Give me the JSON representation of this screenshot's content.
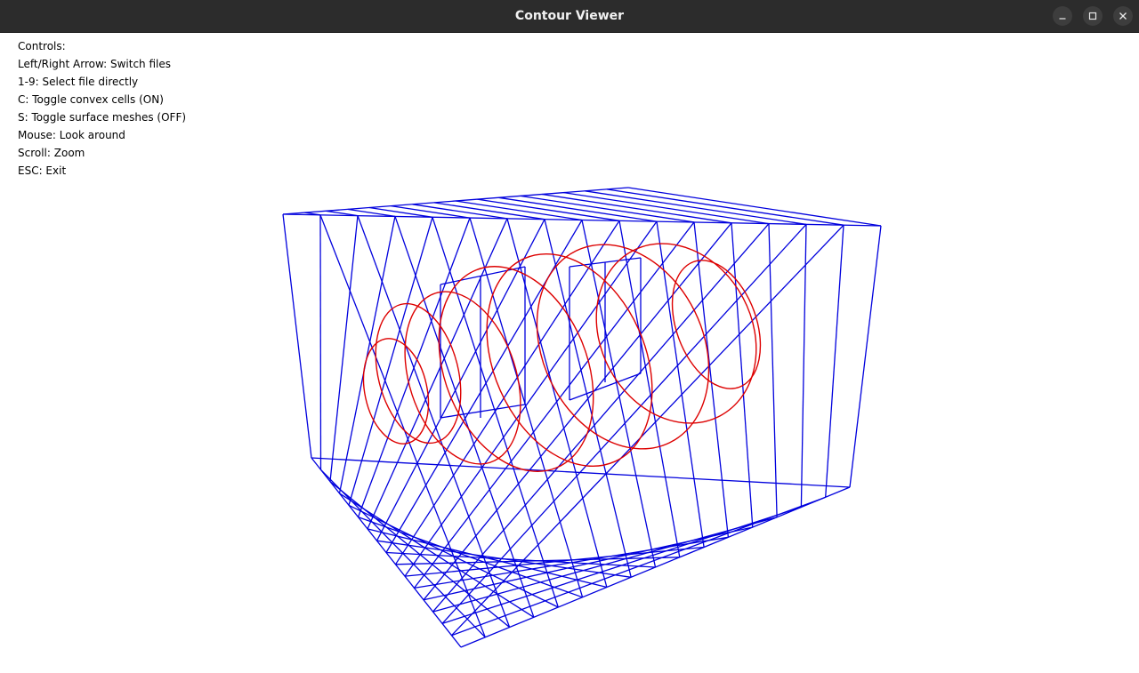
{
  "window": {
    "title": "Contour Viewer",
    "buttons": [
      {
        "name": "minimize",
        "icon": "minimize-icon"
      },
      {
        "name": "maximize",
        "icon": "maximize-icon"
      },
      {
        "name": "close",
        "icon": "close-icon"
      }
    ]
  },
  "controls": [
    "Controls:",
    "Left/Right Arrow: Switch files",
    "1-9: Select file directly",
    "C: Toggle convex cells (ON)",
    "S: Toggle surface meshes (OFF)",
    "Mouse: Look around",
    "Scroll: Zoom",
    "ESC: Exit"
  ],
  "colors": {
    "titlebar": "#2c2c2c",
    "cells": "#0000dd",
    "contours": "#dd0000",
    "background": "#ffffff"
  }
}
